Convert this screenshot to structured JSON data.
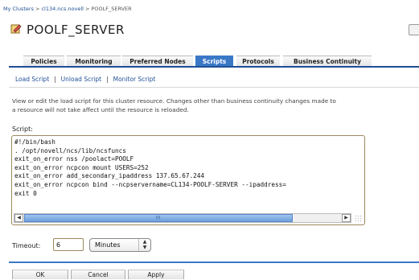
{
  "breadcrumb": {
    "items": [
      "My Clusters",
      "cl134.ncs.novell",
      "POOLF_SERVER"
    ],
    "separator": ">"
  },
  "title": {
    "text": "POOLF_SERVER",
    "icon": "resource-icon"
  },
  "tabs": [
    {
      "label": "Policies",
      "active": false
    },
    {
      "label": "Monitoring",
      "active": false
    },
    {
      "label": "Preferred Nodes",
      "active": false
    },
    {
      "label": "Scripts",
      "active": true
    },
    {
      "label": "Protocols",
      "active": false
    },
    {
      "label": "Business Continuity",
      "active": false
    }
  ],
  "subnav": {
    "items": [
      "Load Script",
      "Unload Script",
      "Monitor Script"
    ],
    "separator": "|"
  },
  "description": {
    "line1": "View or edit the load script for this cluster resource. Changes other than business continuity changes made to",
    "line2": "a resource will not take affect until the resource is reloaded."
  },
  "script": {
    "label": "Script:",
    "lines": [
      "#!/bin/bash",
      ". /opt/novell/ncs/lib/ncsfuncs",
      "exit_on_error nss /poolact=POOLF",
      "exit_on_error ncpcon mount USERS=252",
      "exit_on_error add_secondary_ipaddress 137.65.67.244",
      "exit_on_error ncpcon bind --ncpservername=CL134-POOLF-SERVER --ipaddress=",
      "exit 0"
    ],
    "scroll_thumb_text": "III"
  },
  "timeout": {
    "label": "Timeout:",
    "value": "6",
    "unit": "Minutes"
  },
  "buttons": {
    "ok": "OK",
    "cancel": "Cancel",
    "apply": "Apply"
  },
  "colors": {
    "link": "#1f4e96",
    "active_tab": "#3a78c6",
    "divider": "#3a78c6"
  }
}
